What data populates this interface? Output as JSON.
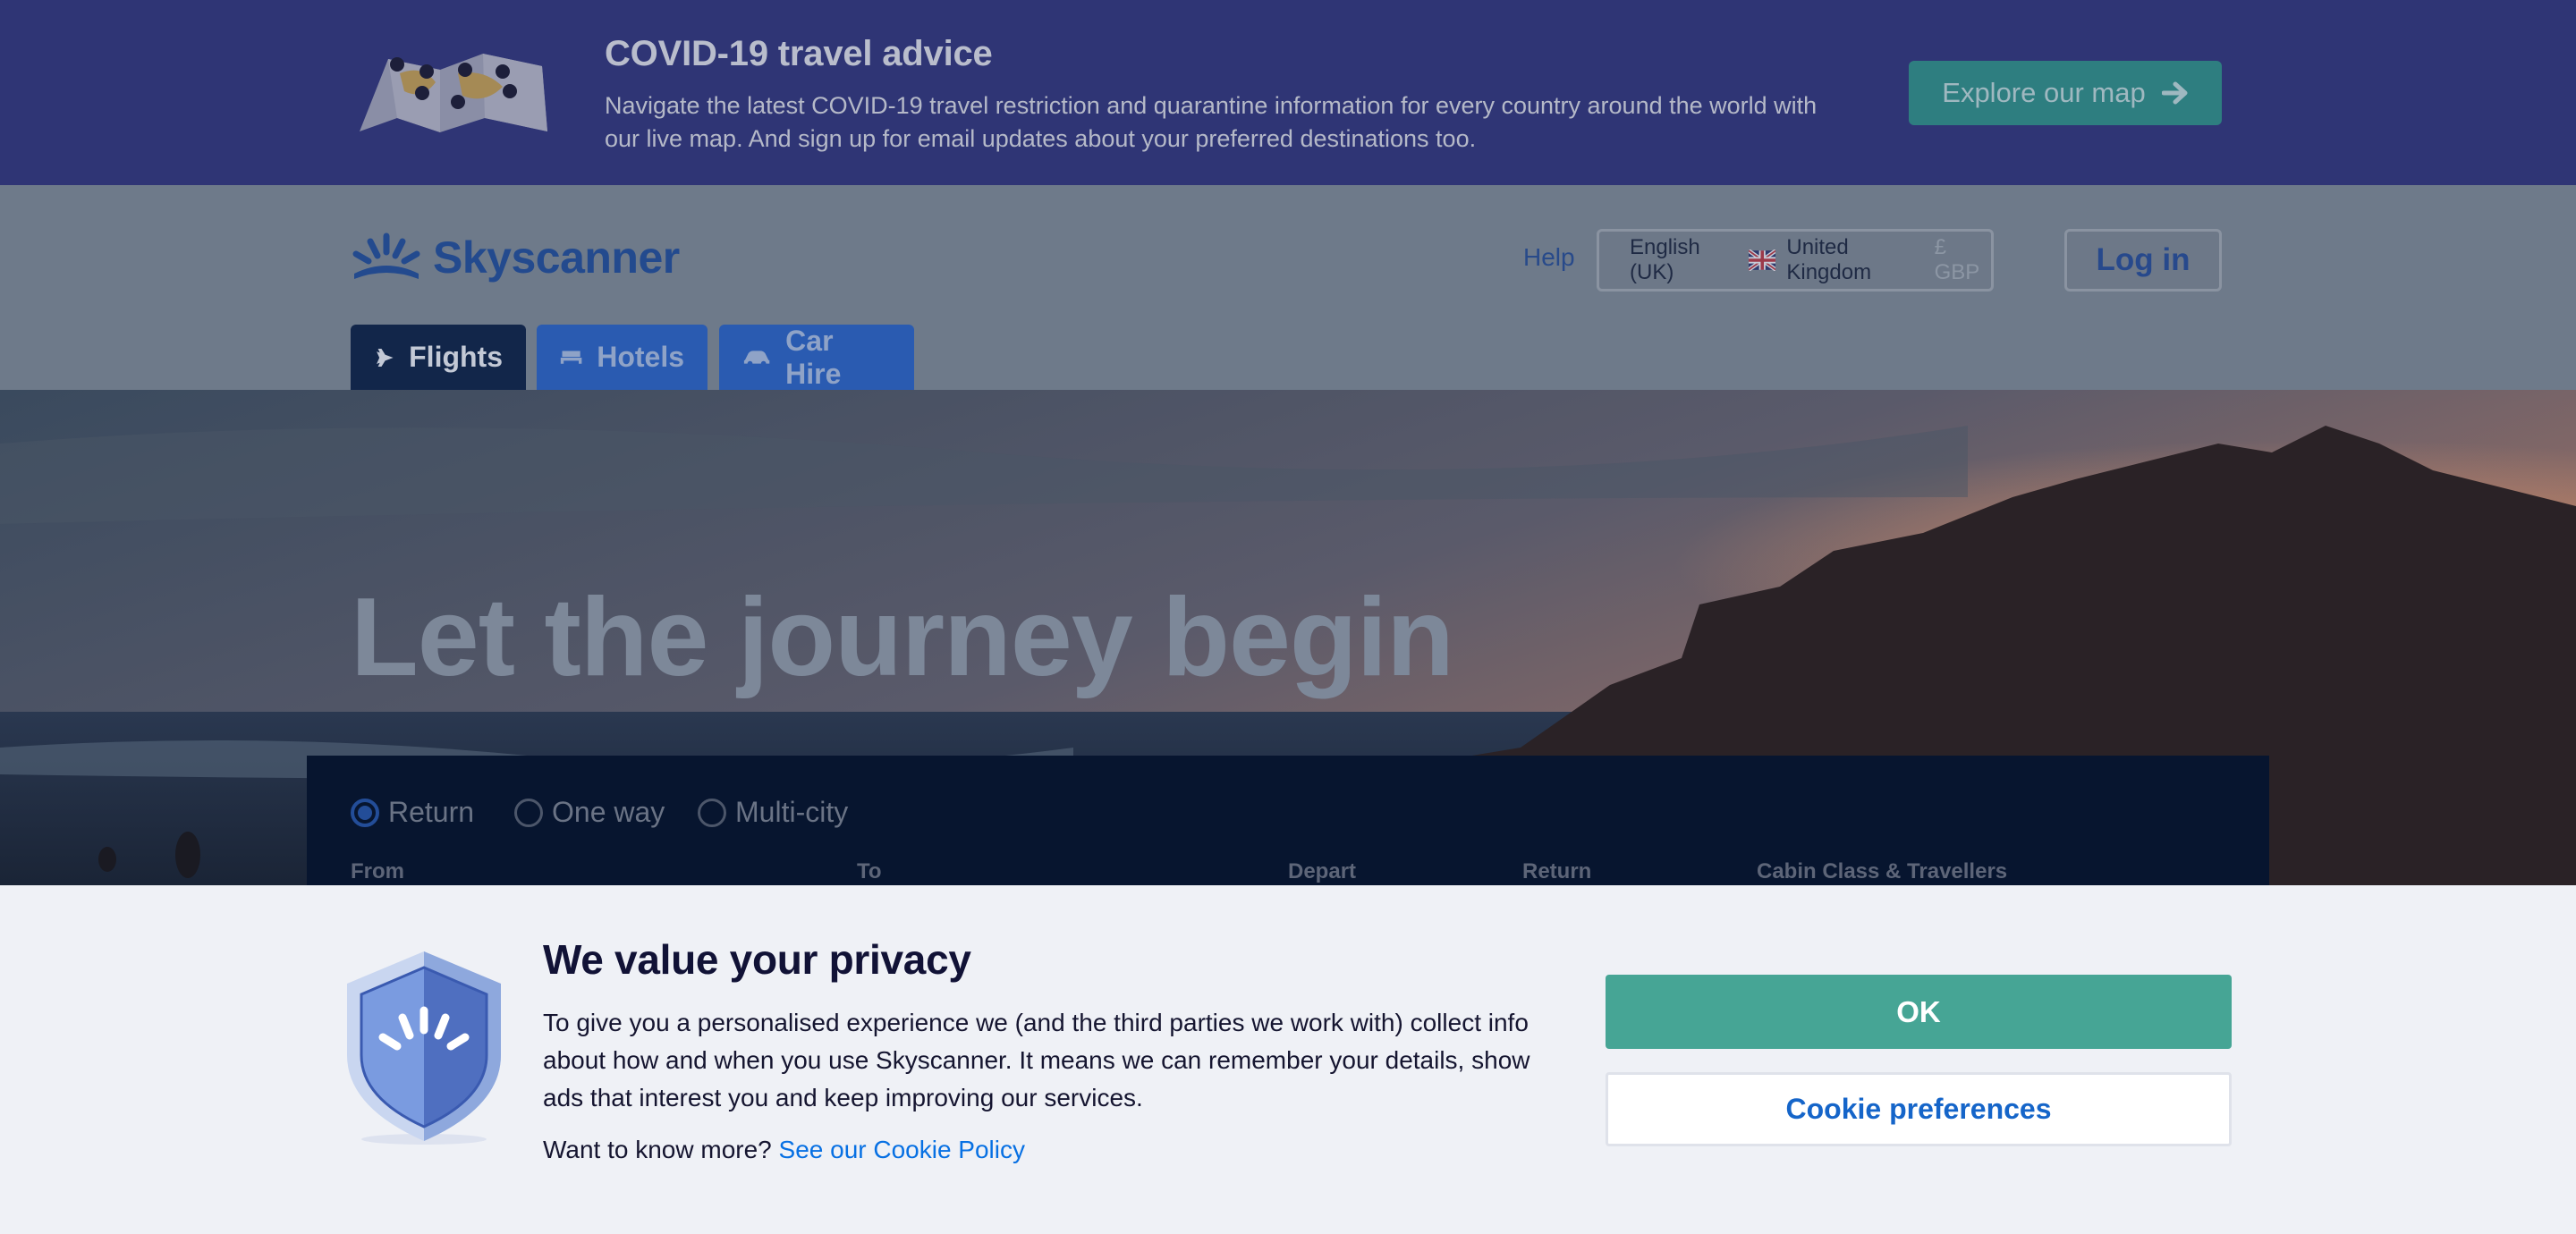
{
  "covid_banner": {
    "title": "COVID-19 travel advice",
    "description": "Navigate the latest COVID-19 travel restriction and quarantine information for every country around the world with our live map. And sign up for email updates about your preferred destinations too.",
    "explore_button": "Explore our map"
  },
  "header": {
    "logo_text": "Skyscanner",
    "help": "Help",
    "locale": {
      "language": "English (UK)",
      "country": "United Kingdom",
      "currency": "£ GBP"
    },
    "login": "Log in"
  },
  "tabs": [
    {
      "label": "Flights",
      "icon": "plane-icon"
    },
    {
      "label": "Hotels",
      "icon": "bed-icon"
    },
    {
      "label": "Car Hire",
      "icon": "car-icon"
    }
  ],
  "hero": {
    "title": "Let the journey begin"
  },
  "search": {
    "trip_types": [
      "Return",
      "One way",
      "Multi-city"
    ],
    "selected_trip_type": "Return",
    "labels": {
      "from": "From",
      "to": "To",
      "depart": "Depart",
      "return": "Return",
      "cabin": "Cabin Class & Travellers"
    }
  },
  "cookie": {
    "title": "We value your privacy",
    "body": "To give you a personalised experience we (and the third parties we work with) collect info about how and when you use Skyscanner. It means we can remember your details, show ads that interest you and keep improving our services.",
    "more_prefix": "Want to know more?",
    "more_link": "See our Cookie Policy",
    "ok": "OK",
    "preferences": "Cookie preferences"
  },
  "colors": {
    "banner_bg": "#2f3575",
    "overlay_header": "#6e7a8a",
    "tab_active": "#12264a",
    "tab_inactive": "#2a5bb1",
    "ok_button": "#46a595",
    "link": "#0770e3"
  }
}
